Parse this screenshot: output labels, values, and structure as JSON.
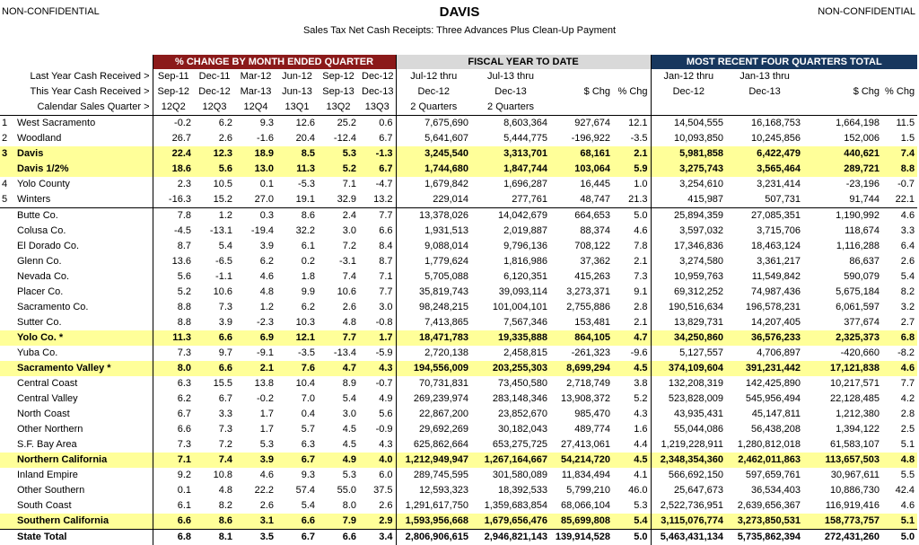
{
  "header": {
    "left_label": "NON-CONFIDENTIAL",
    "right_label": "NON-CONFIDENTIAL",
    "title": "DAVIS",
    "subtitle": "Sales Tax Net Cash Receipts: Three Advances Plus Clean-Up Payment"
  },
  "bands": {
    "change": "% CHANGE BY MONTH ENDED QUARTER",
    "fytd": "FISCAL YEAR TO DATE",
    "recent": "MOST RECENT FOUR QUARTERS TOTAL"
  },
  "row_labels": {
    "last_year": "Last Year Cash Received >",
    "this_year": "This Year Cash Received >",
    "calendar": "Calendar Sales Quarter >"
  },
  "col_headers": {
    "last_year": [
      "Sep-11",
      "Dec-11",
      "Mar-12",
      "Jun-12",
      "Sep-12",
      "Dec-12",
      "Jul-12 thru",
      "Jul-13 thru",
      "",
      "",
      "Jan-12 thru",
      "Jan-13 thru",
      "",
      ""
    ],
    "this_year": [
      "Sep-12",
      "Dec-12",
      "Mar-13",
      "Jun-13",
      "Sep-13",
      "Dec-13",
      "Dec-12",
      "Dec-13",
      "$ Chg",
      "% Chg",
      "Dec-12",
      "Dec-13",
      "$ Chg",
      "% Chg"
    ],
    "calendar": [
      "12Q2",
      "12Q3",
      "12Q4",
      "13Q1",
      "13Q2",
      "13Q3",
      "2 Quarters",
      "2 Quarters",
      "",
      "",
      "",
      "",
      "",
      ""
    ]
  },
  "rows": [
    {
      "idx": "1",
      "name": "West Sacramento",
      "vals": [
        "-0.2",
        "6.2",
        "9.3",
        "12.6",
        "25.2",
        "0.6",
        "7,675,690",
        "8,603,364",
        "927,674",
        "12.1",
        "14,504,555",
        "16,168,753",
        "1,664,198",
        "11.5"
      ],
      "style": ""
    },
    {
      "idx": "2",
      "name": "Woodland",
      "vals": [
        "26.7",
        "2.6",
        "-1.6",
        "20.4",
        "-12.4",
        "6.7",
        "5,641,607",
        "5,444,775",
        "-196,922",
        "-3.5",
        "10,093,850",
        "10,245,856",
        "152,006",
        "1.5"
      ],
      "style": ""
    },
    {
      "idx": "3",
      "name": "Davis",
      "vals": [
        "22.4",
        "12.3",
        "18.9",
        "8.5",
        "5.3",
        "-1.3",
        "3,245,540",
        "3,313,701",
        "68,161",
        "2.1",
        "5,981,858",
        "6,422,479",
        "440,621",
        "7.4"
      ],
      "style": "yb"
    },
    {
      "idx": "",
      "name": "Davis 1/2%",
      "vals": [
        "18.6",
        "5.6",
        "13.0",
        "11.3",
        "5.2",
        "6.7",
        "1,744,680",
        "1,847,744",
        "103,064",
        "5.9",
        "3,275,743",
        "3,565,464",
        "289,721",
        "8.8"
      ],
      "style": "yb"
    },
    {
      "idx": "4",
      "name": "Yolo County",
      "vals": [
        "2.3",
        "10.5",
        "0.1",
        "-5.3",
        "7.1",
        "-4.7",
        "1,679,842",
        "1,696,287",
        "16,445",
        "1.0",
        "3,254,610",
        "3,231,414",
        "-23,196",
        "-0.7"
      ],
      "style": ""
    },
    {
      "idx": "5",
      "name": "Winters",
      "vals": [
        "-16.3",
        "15.2",
        "27.0",
        "19.1",
        "32.9",
        "13.2",
        "229,014",
        "277,761",
        "48,747",
        "21.3",
        "415,987",
        "507,731",
        "91,744",
        "22.1"
      ],
      "style": "end"
    },
    {
      "idx": "",
      "name": "Butte Co.",
      "vals": [
        "7.8",
        "1.2",
        "0.3",
        "8.6",
        "2.4",
        "7.7",
        "13,378,026",
        "14,042,679",
        "664,653",
        "5.0",
        "25,894,359",
        "27,085,351",
        "1,190,992",
        "4.6"
      ],
      "style": ""
    },
    {
      "idx": "",
      "name": "Colusa Co.",
      "vals": [
        "-4.5",
        "-13.1",
        "-19.4",
        "32.2",
        "3.0",
        "6.6",
        "1,931,513",
        "2,019,887",
        "88,374",
        "4.6",
        "3,597,032",
        "3,715,706",
        "118,674",
        "3.3"
      ],
      "style": ""
    },
    {
      "idx": "",
      "name": "El Dorado Co.",
      "vals": [
        "8.7",
        "5.4",
        "3.9",
        "6.1",
        "7.2",
        "8.4",
        "9,088,014",
        "9,796,136",
        "708,122",
        "7.8",
        "17,346,836",
        "18,463,124",
        "1,116,288",
        "6.4"
      ],
      "style": ""
    },
    {
      "idx": "",
      "name": "Glenn Co.",
      "vals": [
        "13.6",
        "-6.5",
        "6.2",
        "0.2",
        "-3.1",
        "8.7",
        "1,779,624",
        "1,816,986",
        "37,362",
        "2.1",
        "3,274,580",
        "3,361,217",
        "86,637",
        "2.6"
      ],
      "style": ""
    },
    {
      "idx": "",
      "name": "Nevada Co.",
      "vals": [
        "5.6",
        "-1.1",
        "4.6",
        "1.8",
        "7.4",
        "7.1",
        "5,705,088",
        "6,120,351",
        "415,263",
        "7.3",
        "10,959,763",
        "11,549,842",
        "590,079",
        "5.4"
      ],
      "style": ""
    },
    {
      "idx": "",
      "name": "Placer Co.",
      "vals": [
        "5.2",
        "10.6",
        "4.8",
        "9.9",
        "10.6",
        "7.7",
        "35,819,743",
        "39,093,114",
        "3,273,371",
        "9.1",
        "69,312,252",
        "74,987,436",
        "5,675,184",
        "8.2"
      ],
      "style": ""
    },
    {
      "idx": "",
      "name": "Sacramento Co.",
      "vals": [
        "8.8",
        "7.3",
        "1.2",
        "6.2",
        "2.6",
        "3.0",
        "98,248,215",
        "101,004,101",
        "2,755,886",
        "2.8",
        "190,516,634",
        "196,578,231",
        "6,061,597",
        "3.2"
      ],
      "style": ""
    },
    {
      "idx": "",
      "name": "Sutter Co.",
      "vals": [
        "8.8",
        "3.9",
        "-2.3",
        "10.3",
        "4.8",
        "-0.8",
        "7,413,865",
        "7,567,346",
        "153,481",
        "2.1",
        "13,829,731",
        "14,207,405",
        "377,674",
        "2.7"
      ],
      "style": ""
    },
    {
      "idx": "",
      "name": "Yolo Co. *",
      "vals": [
        "11.3",
        "6.6",
        "6.9",
        "12.1",
        "7.7",
        "1.7",
        "18,471,783",
        "19,335,888",
        "864,105",
        "4.7",
        "34,250,860",
        "36,576,233",
        "2,325,373",
        "6.8"
      ],
      "style": "yb"
    },
    {
      "idx": "",
      "name": "Yuba Co.",
      "vals": [
        "7.3",
        "9.7",
        "-9.1",
        "-3.5",
        "-13.4",
        "-5.9",
        "2,720,138",
        "2,458,815",
        "-261,323",
        "-9.6",
        "5,127,557",
        "4,706,897",
        "-420,660",
        "-8.2"
      ],
      "style": ""
    },
    {
      "idx": "",
      "name": "Sacramento Valley *",
      "vals": [
        "8.0",
        "6.6",
        "2.1",
        "7.6",
        "4.7",
        "4.3",
        "194,556,009",
        "203,255,303",
        "8,699,294",
        "4.5",
        "374,109,604",
        "391,231,442",
        "17,121,838",
        "4.6"
      ],
      "style": "yb"
    },
    {
      "idx": "",
      "name": "Central Coast",
      "vals": [
        "6.3",
        "15.5",
        "13.8",
        "10.4",
        "8.9",
        "-0.7",
        "70,731,831",
        "73,450,580",
        "2,718,749",
        "3.8",
        "132,208,319",
        "142,425,890",
        "10,217,571",
        "7.7"
      ],
      "style": ""
    },
    {
      "idx": "",
      "name": "Central Valley",
      "vals": [
        "6.2",
        "6.7",
        "-0.2",
        "7.0",
        "5.4",
        "4.9",
        "269,239,974",
        "283,148,346",
        "13,908,372",
        "5.2",
        "523,828,009",
        "545,956,494",
        "22,128,485",
        "4.2"
      ],
      "style": ""
    },
    {
      "idx": "",
      "name": "North Coast",
      "vals": [
        "6.7",
        "3.3",
        "1.7",
        "0.4",
        "3.0",
        "5.6",
        "22,867,200",
        "23,852,670",
        "985,470",
        "4.3",
        "43,935,431",
        "45,147,811",
        "1,212,380",
        "2.8"
      ],
      "style": ""
    },
    {
      "idx": "",
      "name": "Other Northern",
      "vals": [
        "6.6",
        "7.3",
        "1.7",
        "5.7",
        "4.5",
        "-0.9",
        "29,692,269",
        "30,182,043",
        "489,774",
        "1.6",
        "55,044,086",
        "56,438,208",
        "1,394,122",
        "2.5"
      ],
      "style": ""
    },
    {
      "idx": "",
      "name": "S.F. Bay Area",
      "vals": [
        "7.3",
        "7.2",
        "5.3",
        "6.3",
        "4.5",
        "4.3",
        "625,862,664",
        "653,275,725",
        "27,413,061",
        "4.4",
        "1,219,228,911",
        "1,280,812,018",
        "61,583,107",
        "5.1"
      ],
      "style": ""
    },
    {
      "idx": "",
      "name": "Northern California",
      "vals": [
        "7.1",
        "7.4",
        "3.9",
        "6.7",
        "4.9",
        "4.0",
        "1,212,949,947",
        "1,267,164,667",
        "54,214,720",
        "4.5",
        "2,348,354,360",
        "2,462,011,863",
        "113,657,503",
        "4.8"
      ],
      "style": "yb"
    },
    {
      "idx": "",
      "name": "Inland Empire",
      "vals": [
        "9.2",
        "10.8",
        "4.6",
        "9.3",
        "5.3",
        "6.0",
        "289,745,595",
        "301,580,089",
        "11,834,494",
        "4.1",
        "566,692,150",
        "597,659,761",
        "30,967,611",
        "5.5"
      ],
      "style": ""
    },
    {
      "idx": "",
      "name": "Other Southern",
      "vals": [
        "0.1",
        "4.8",
        "22.2",
        "57.4",
        "55.0",
        "37.5",
        "12,593,323",
        "18,392,533",
        "5,799,210",
        "46.0",
        "25,647,673",
        "36,534,403",
        "10,886,730",
        "42.4"
      ],
      "style": ""
    },
    {
      "idx": "",
      "name": "South Coast",
      "vals": [
        "6.1",
        "8.2",
        "2.6",
        "5.4",
        "8.0",
        "2.6",
        "1,291,617,750",
        "1,359,683,854",
        "68,066,104",
        "5.3",
        "2,522,736,951",
        "2,639,656,367",
        "116,919,416",
        "4.6"
      ],
      "style": ""
    },
    {
      "idx": "",
      "name": "Southern California",
      "vals": [
        "6.6",
        "8.6",
        "3.1",
        "6.6",
        "7.9",
        "2.9",
        "1,593,956,668",
        "1,679,656,476",
        "85,699,808",
        "5.4",
        "3,115,076,774",
        "3,273,850,531",
        "158,773,757",
        "5.1"
      ],
      "style": "yb"
    },
    {
      "idx": "",
      "name": "State Total",
      "vals": [
        "6.8",
        "8.1",
        "3.5",
        "6.7",
        "6.6",
        "3.4",
        "2,806,906,615",
        "2,946,821,143",
        "139,914,528",
        "5.0",
        "5,463,431,134",
        "5,735,862,394",
        "272,431,260",
        "5.0"
      ],
      "style": "total"
    }
  ]
}
